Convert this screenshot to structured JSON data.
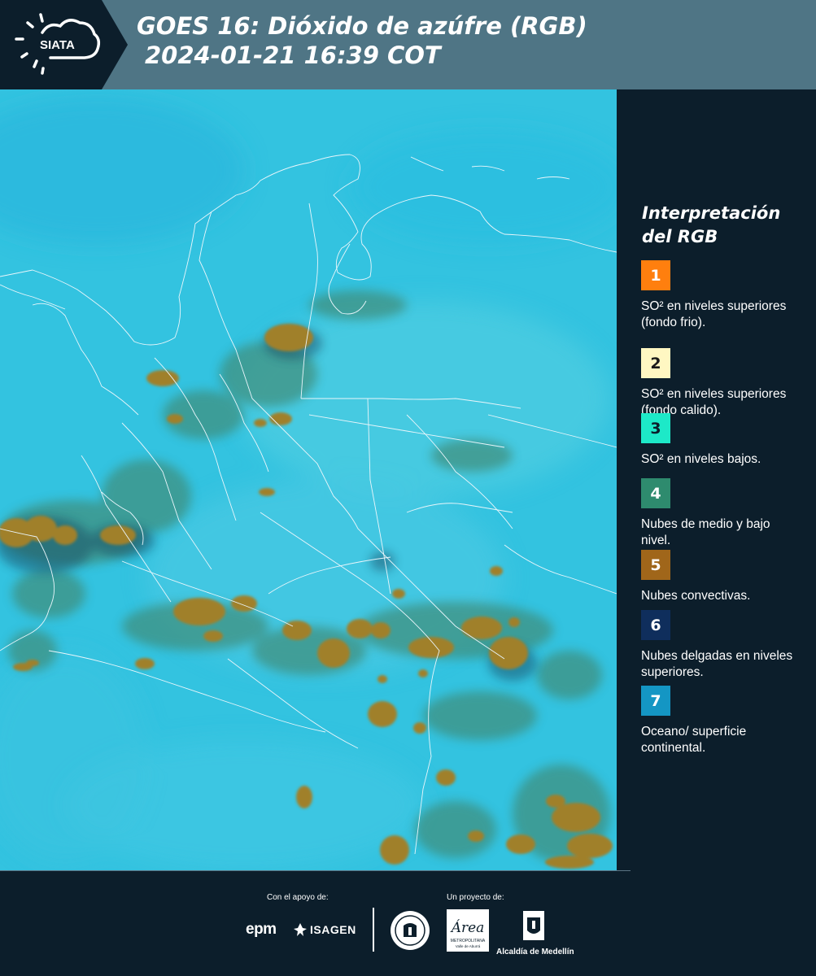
{
  "header": {
    "logo_text": "SIATA",
    "title_line1": "GOES 16: Dióxido de azúfre (RGB)",
    "title_line2": "2024-01-21 16:39 COT"
  },
  "colors": {
    "header_bg": "#4f7585",
    "panel_bg": "#0c1e2b",
    "map_background": "#33c3e0",
    "convective_cloud": "#a0802c",
    "mid_low_cloud": "#3f8d7a"
  },
  "legend": {
    "title": "Interpretación del RGB",
    "items": [
      {
        "number": "1",
        "color": "#ff7f0e",
        "text_color": "#ffffff",
        "text": "SO² en niveles superiores (fondo frio)."
      },
      {
        "number": "2",
        "color": "#fff7c2",
        "text_color": "#1a1a1a",
        "text": "SO² en niveles superiores (fondo calido)."
      },
      {
        "number": "3",
        "color": "#1de9c8",
        "text_color": "#0c1e2b",
        "text": "SO² en niveles bajos."
      },
      {
        "number": "4",
        "color": "#2e8b6e",
        "text_color": "#ffffff",
        "text": "Nubes de medio y bajo nivel."
      },
      {
        "number": "5",
        "color": "#a0661a",
        "text_color": "#ffffff",
        "text": "Nubes convectivas."
      },
      {
        "number": "6",
        "color": "#0f2e5c",
        "text_color": "#ffffff",
        "text": "Nubes delgadas en niveles superiores."
      },
      {
        "number": "7",
        "color": "#1496c4",
        "text_color": "#ffffff",
        "text": "Oceano/ superficie continental."
      }
    ]
  },
  "footer": {
    "support_label": "Con el apoyo de:",
    "project_label": "Un proyecto de:",
    "sponsors": [
      "epm",
      "ISAGEN"
    ],
    "partners": [
      "Área Metropolitana Valle de Aburrá",
      "Alcaldía de Medellín"
    ],
    "area_logo_text": "Área",
    "area_logo_subtext": "METROPOLITANA",
    "area_logo_subtext2": "Valle de Aburrá",
    "alcaldia_text": "Alcaldía de Medellín"
  }
}
